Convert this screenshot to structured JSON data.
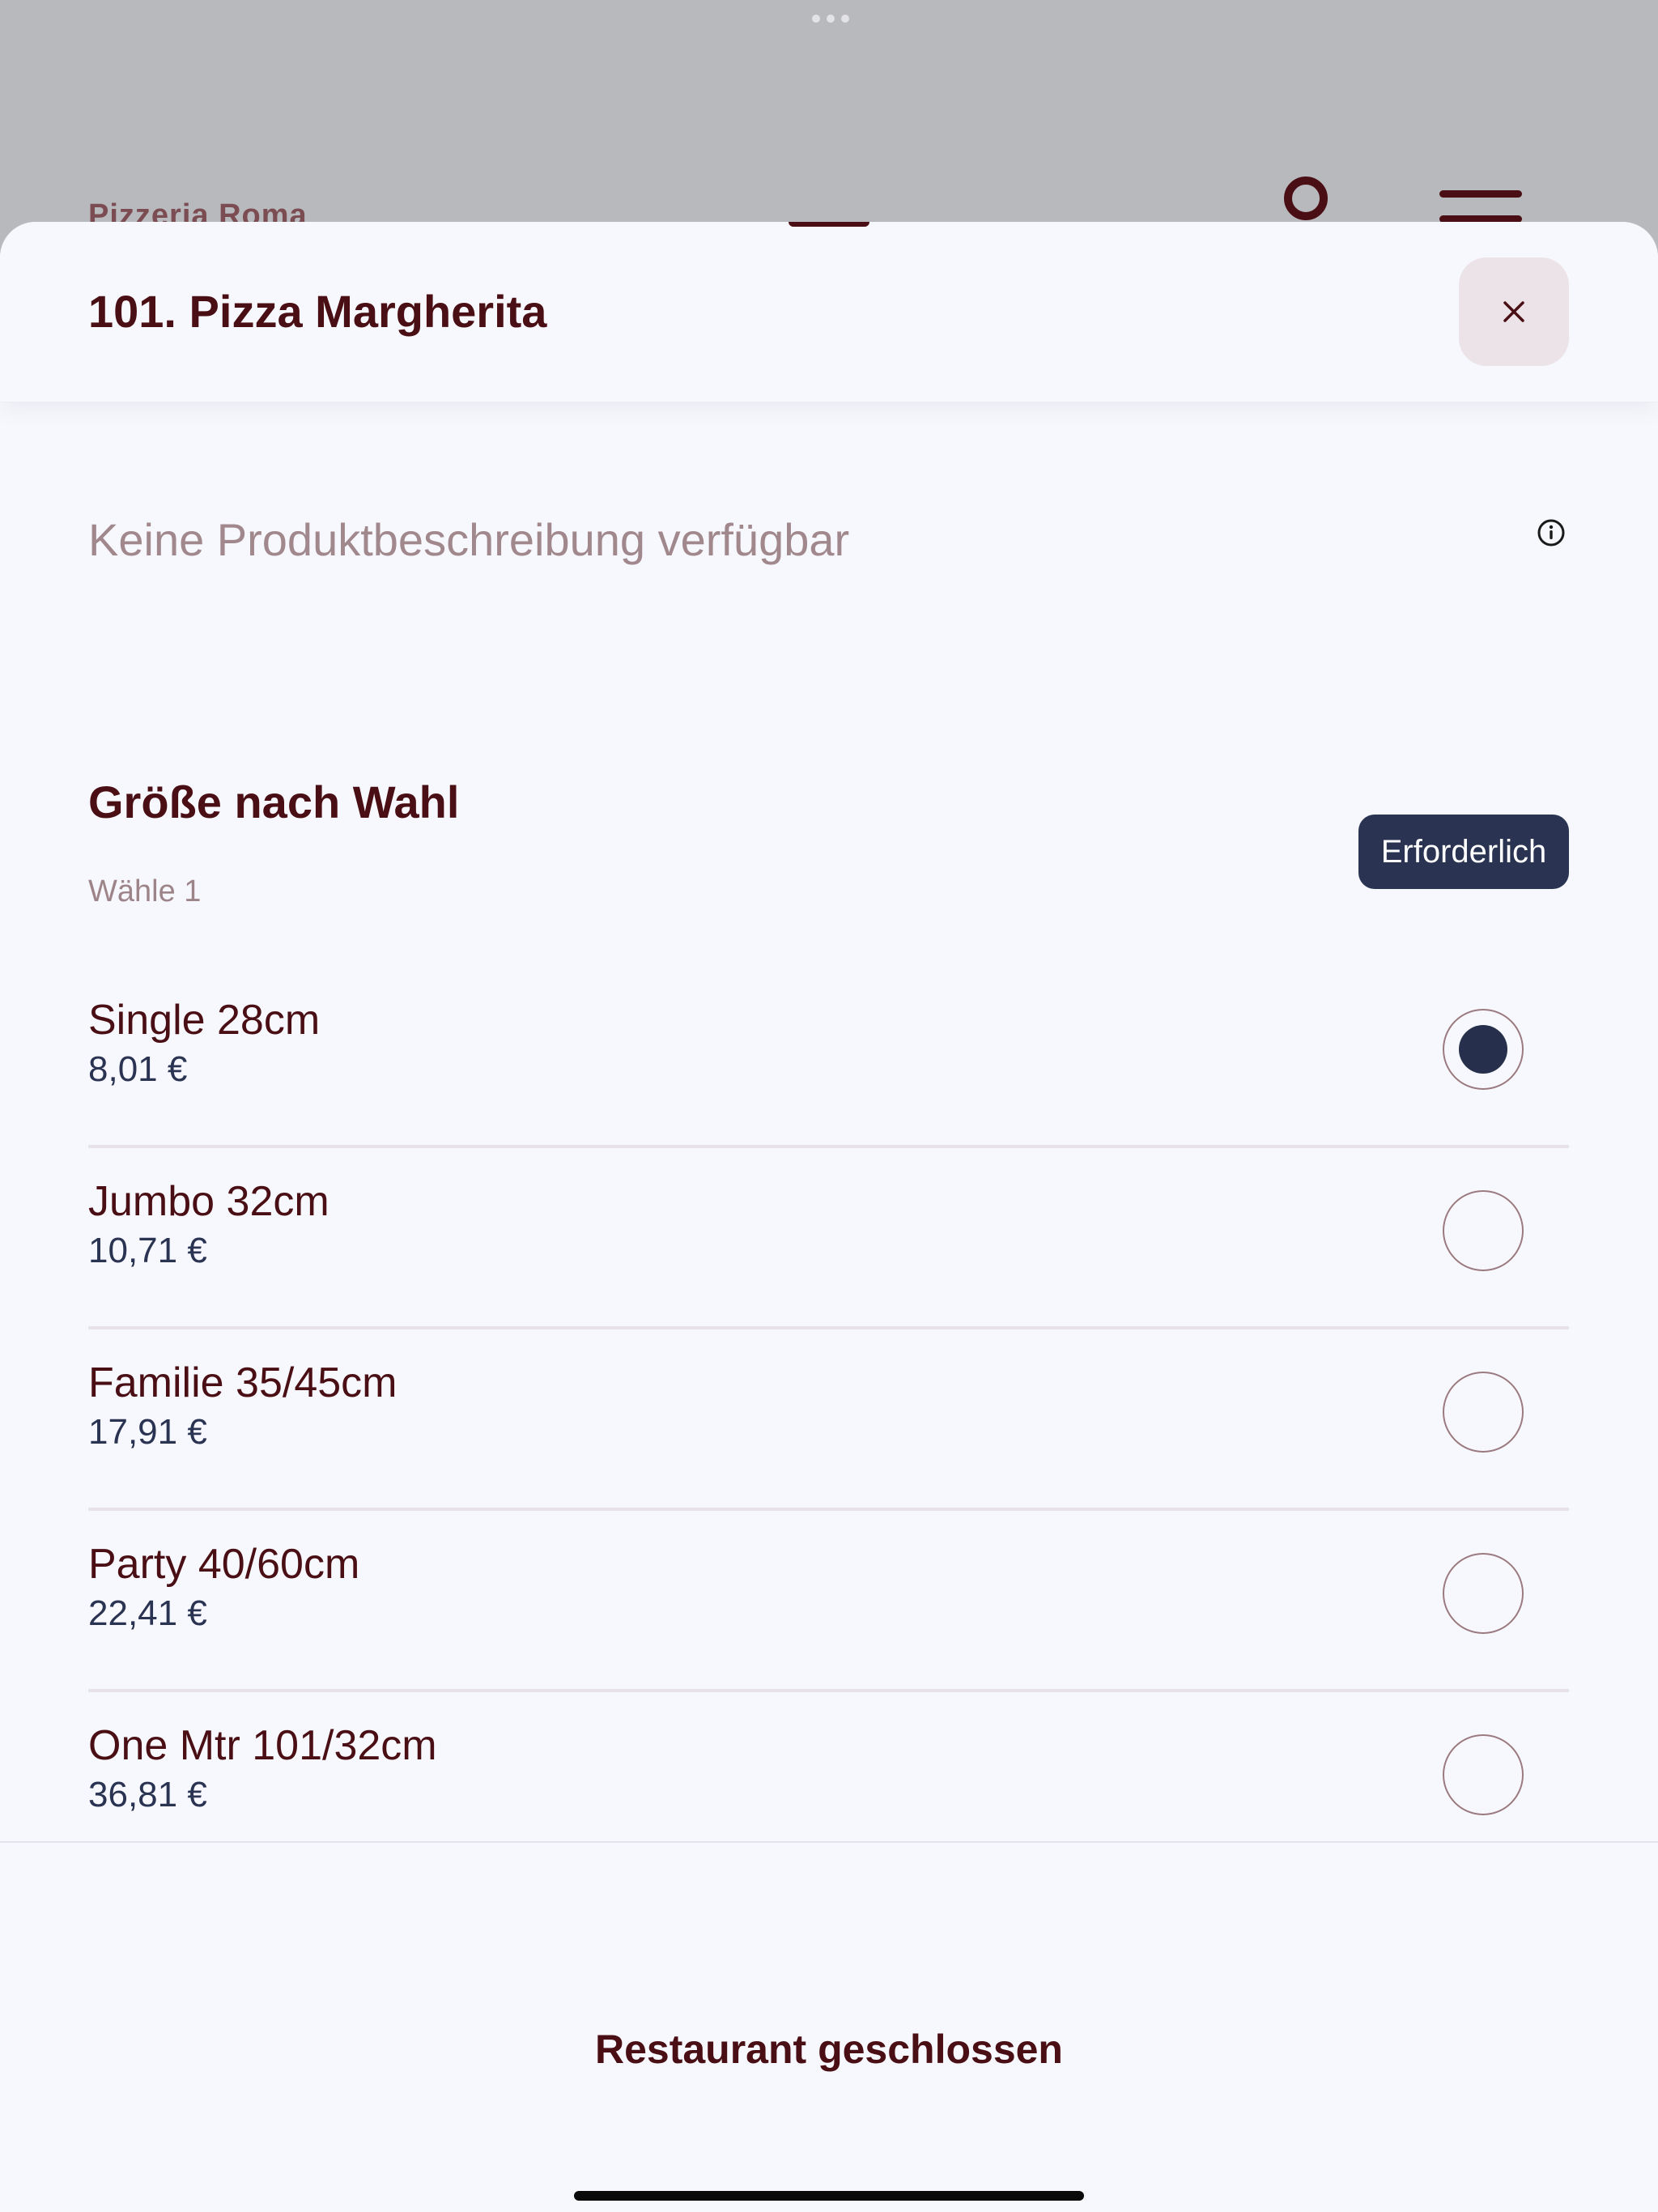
{
  "background": {
    "brand": "Pizzeria Roma",
    "user_icon": "user-icon",
    "menu_icon": "hamburger-menu-icon"
  },
  "sheet": {
    "title": "101. Pizza Margherita",
    "close_icon": "close-icon",
    "description": "Keine Produktbeschreibung verfügbar",
    "info_icon": "info-icon"
  },
  "option_group": {
    "title": "Größe nach Wahl",
    "subtitle": "Wähle 1",
    "badge": "Erforderlich",
    "options": [
      {
        "name": "Single 28cm",
        "price": "8,01 €",
        "selected": true
      },
      {
        "name": "Jumbo 32cm",
        "price": "10,71 €",
        "selected": false
      },
      {
        "name": "Familie 35/45cm",
        "price": "17,91 €",
        "selected": false
      },
      {
        "name": "Party 40/60cm",
        "price": "22,41 €",
        "selected": false
      },
      {
        "name": "One Mtr 101/32cm",
        "price": "36,81 €",
        "selected": false
      }
    ]
  },
  "footer": {
    "status": "Restaurant geschlossen"
  },
  "colors": {
    "primary_text": "#4a0f14",
    "accent_navy": "#2a3452",
    "muted_text": "#a0888d",
    "sheet_bg": "#f7f8fd",
    "backdrop": "#b8b9bd"
  }
}
